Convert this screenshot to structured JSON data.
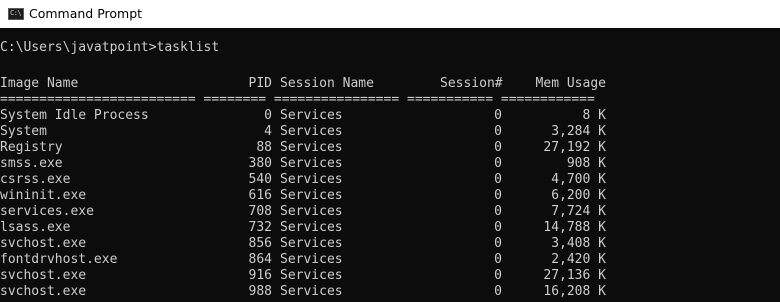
{
  "window": {
    "title": "Command Prompt",
    "icon": "cmd-icon",
    "icon_glyph": "C:\\"
  },
  "console": {
    "prompt": "C:\\Users\\javatpoint>tasklist",
    "headers": {
      "image_name": "Image Name",
      "pid": "PID",
      "session_name": "Session Name",
      "session_num": "Session#",
      "mem_usage": "Mem Usage"
    },
    "separator": "========================= ======== ================ =========== ============",
    "rows": [
      {
        "name": "System Idle Process",
        "pid": "0",
        "session": "Services",
        "snum": "0",
        "mem": "8 K"
      },
      {
        "name": "System",
        "pid": "4",
        "session": "Services",
        "snum": "0",
        "mem": "3,284 K"
      },
      {
        "name": "Registry",
        "pid": "88",
        "session": "Services",
        "snum": "0",
        "mem": "27,192 K"
      },
      {
        "name": "smss.exe",
        "pid": "380",
        "session": "Services",
        "snum": "0",
        "mem": "908 K"
      },
      {
        "name": "csrss.exe",
        "pid": "540",
        "session": "Services",
        "snum": "0",
        "mem": "4,700 K"
      },
      {
        "name": "wininit.exe",
        "pid": "616",
        "session": "Services",
        "snum": "0",
        "mem": "6,200 K"
      },
      {
        "name": "services.exe",
        "pid": "708",
        "session": "Services",
        "snum": "0",
        "mem": "7,724 K"
      },
      {
        "name": "lsass.exe",
        "pid": "732",
        "session": "Services",
        "snum": "0",
        "mem": "14,788 K"
      },
      {
        "name": "svchost.exe",
        "pid": "856",
        "session": "Services",
        "snum": "0",
        "mem": "3,408 K"
      },
      {
        "name": "fontdrvhost.exe",
        "pid": "864",
        "session": "Services",
        "snum": "0",
        "mem": "2,420 K"
      },
      {
        "name": "svchost.exe",
        "pid": "916",
        "session": "Services",
        "snum": "0",
        "mem": "27,136 K"
      },
      {
        "name": "svchost.exe",
        "pid": "988",
        "session": "Services",
        "snum": "0",
        "mem": "16,208 K"
      }
    ]
  }
}
